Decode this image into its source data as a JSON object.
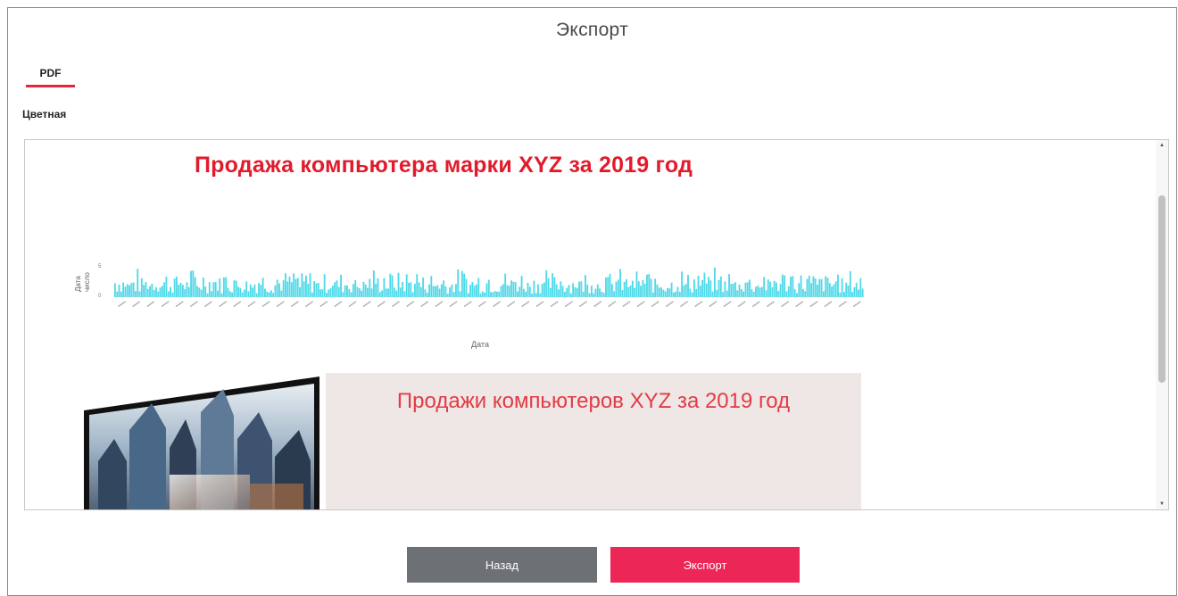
{
  "dialog": {
    "title": "Экспорт",
    "tab_label": "PDF",
    "color_mode_label": "Цветная"
  },
  "preview": {
    "report_title": "Продажа компьютера марки XYZ за 2019 год",
    "info_panel_title": "Продажи компьютеров XYZ за 2019 год"
  },
  "chart_data": {
    "type": "bar",
    "xlabel": "Дата",
    "ylabel": "число",
    "y_axis_caption": "Дата",
    "color": "#4fd9e8",
    "note": "dense daily bar chart, 365 bars; values not legible at this scale"
  },
  "colors": {
    "accent": "#e5273e",
    "export_button": "#ec2656",
    "back_button": "#6d7176",
    "report_title": "#e21b2c"
  },
  "buttons": {
    "back_label": "Назад",
    "export_label": "Экспорт"
  }
}
